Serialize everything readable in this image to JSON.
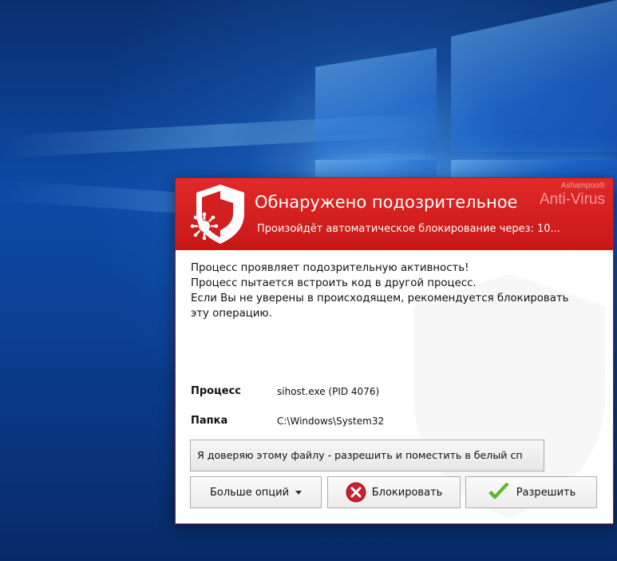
{
  "dialog": {
    "brand_small": "Ashampoo®",
    "brand_big": "Anti-Virus",
    "title": "Обнаружено подозрительное",
    "subtitle": "Произойдёт автоматическое блокирование через: 10...",
    "message_lines": [
      "Процесс проявляет подозрительную активность!",
      "Процесс пытается встроить код в другой процесс.",
      "Если Вы не уверены в происходящем, рекомендуется блокировать",
      "эту операцию."
    ],
    "process_label": "Процесс",
    "process_value": "sihost.exe (PID 4076)",
    "folder_label": "Папка",
    "folder_value": "C:\\Windows\\System32",
    "trust_button": "Я доверяю этому файлу - разрешить и поместить в белый сп",
    "more_options_button": "Больше опций",
    "block_button": "Блокировать",
    "allow_button": "Разрешить"
  },
  "icons": {
    "shield": "shield-virus-icon",
    "block": "block-x-icon",
    "allow": "checkmark-icon",
    "dropdown": "caret-down-icon"
  },
  "colors": {
    "header_red": "#d21f1f",
    "block_icon_red": "#c8202c",
    "allow_icon_green": "#5ab829"
  }
}
